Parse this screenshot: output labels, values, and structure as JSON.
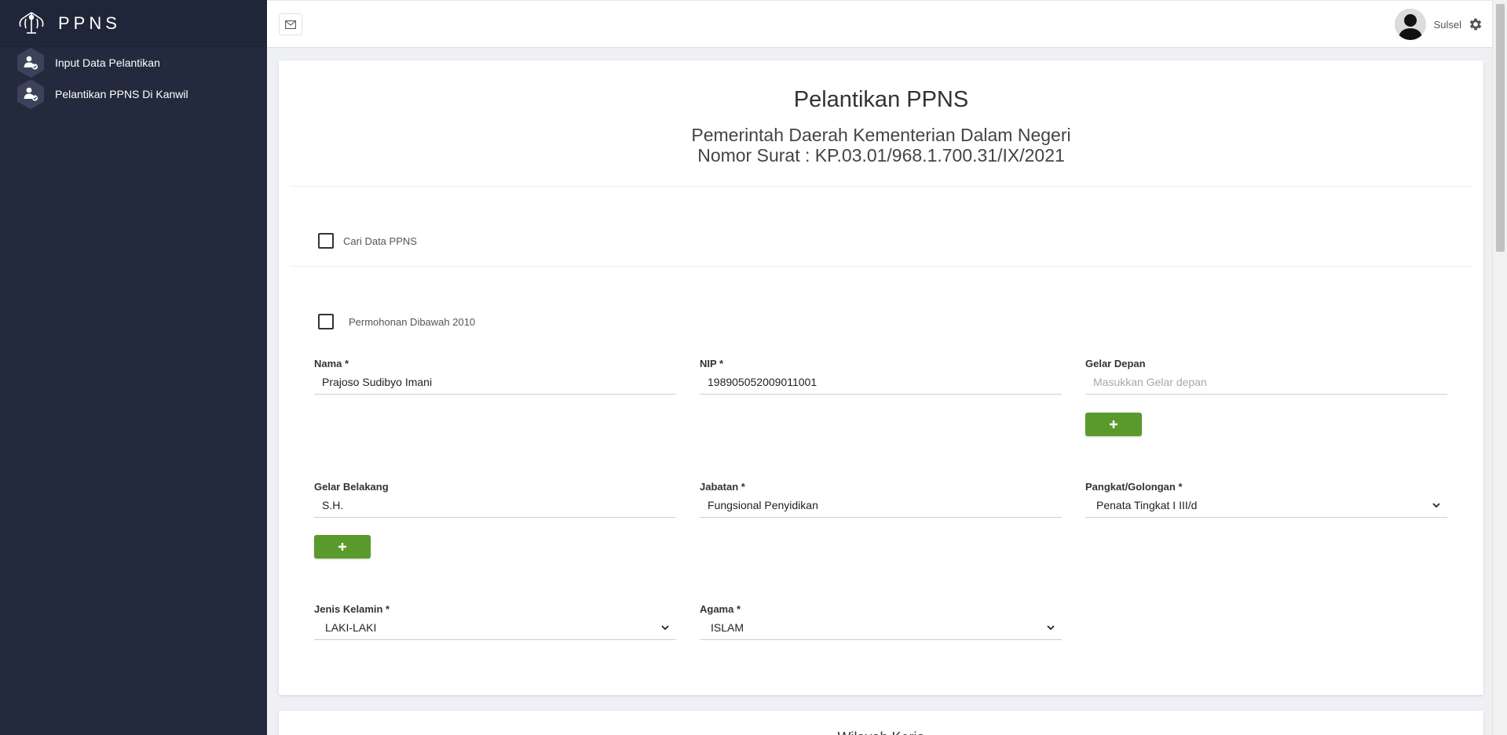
{
  "brand": {
    "name": "PPNS"
  },
  "sidebar": {
    "items": [
      {
        "label": "Input Data Pelantikan"
      },
      {
        "label": "Pelantikan PPNS Di Kanwil"
      }
    ]
  },
  "topbar": {
    "user_name": "Sulsel"
  },
  "card": {
    "title": "Pelantikan PPNS",
    "subtitle_line1": "Pemerintah Daerah Kementerian Dalam Negeri",
    "subtitle_line2": "Nomor Surat : KP.03.01/968.1.700.31/IX/2021"
  },
  "checks": {
    "cari_label": "Cari Data PPNS",
    "permohonan_label": "Permohonan Dibawah 2010"
  },
  "form": {
    "nama": {
      "label": "Nama *",
      "value": "Prajoso Sudibyo Imani"
    },
    "nip": {
      "label": "NIP *",
      "value": "198905052009011001"
    },
    "gelar_depan": {
      "label": "Gelar Depan",
      "value": "",
      "placeholder": "Masukkan Gelar depan"
    },
    "gelar_belakang": {
      "label": "Gelar Belakang",
      "value": "S.H."
    },
    "jabatan": {
      "label": "Jabatan *",
      "value": "Fungsional Penyidikan"
    },
    "pangkat": {
      "label": "Pangkat/Golongan *",
      "value": "Penata Tingkat I III/d"
    },
    "jenis_kelamin": {
      "label": "Jenis Kelamin *",
      "value": "LAKI-LAKI"
    },
    "agama": {
      "label": "Agama *",
      "value": "ISLAM"
    },
    "add_symbol": "+"
  },
  "card2": {
    "title": "Wilayah Kerja"
  },
  "colors": {
    "sidebar": "#242a3d",
    "accent_green": "#5a9a2c"
  },
  "icons": [
    "logo-icon",
    "user-check-icon",
    "mail-icon",
    "avatar-icon",
    "gear-icon",
    "plus-icon",
    "chevron-down-icon"
  ]
}
